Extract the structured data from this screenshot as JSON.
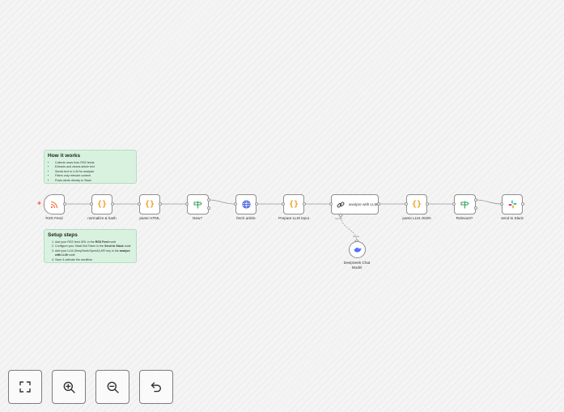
{
  "how_it_works": {
    "title": "How it works",
    "items": [
      "Collects news from RSS feeds",
      "Extracts and cleans article text",
      "Sends text to LLM for analysis",
      "Filters only relevant content",
      "Posts alerts directly to Slack"
    ]
  },
  "setup_steps": {
    "title": "Setup steps",
    "step1": "Add your RSS feed URL in the ",
    "step1_bold": "RSS Feed",
    "step1_end": " node",
    "step2": "Configure your Slack Bot Token in the ",
    "step2_bold": "Send to Slack",
    "step2_end": " node",
    "step3": "Add your LLM (DeepSeek/OpenAI) API key in the ",
    "step3_bold": "analyze with LLM",
    "step3_end": " node",
    "step4": "Save & activate the workflow"
  },
  "nodes": {
    "rss_feed": "RSS Feed",
    "normalize": "normalize & hash",
    "parse_html": "parse HTML",
    "new": "New?",
    "fetch_article": "fetch article",
    "prepare_llm": "Prepare LLM input",
    "analyze_llm": "analyze with LLM",
    "parse_llm_json": "parse LLM JSON",
    "relevant": "Relevant?",
    "send_slack": "send to Slack",
    "deepseek": "DeepSeek Chat Model"
  },
  "connector_labels": {
    "model_in": "Model*",
    "model_out": "Model"
  },
  "toolbar": {
    "fit_view": "fit-view",
    "zoom_in": "zoom-in",
    "zoom_out": "zoom-out",
    "undo": "undo"
  },
  "colors": {
    "sticky_bg": "#d9f2e0",
    "rss_orange": "#f26b3a",
    "code_orange": "#f0a020",
    "if_green": "#2f9e55",
    "http_blue": "#3b5bdb",
    "deepseek_blue": "#4d6bfe",
    "trigger_star": "#ff6d5a"
  }
}
